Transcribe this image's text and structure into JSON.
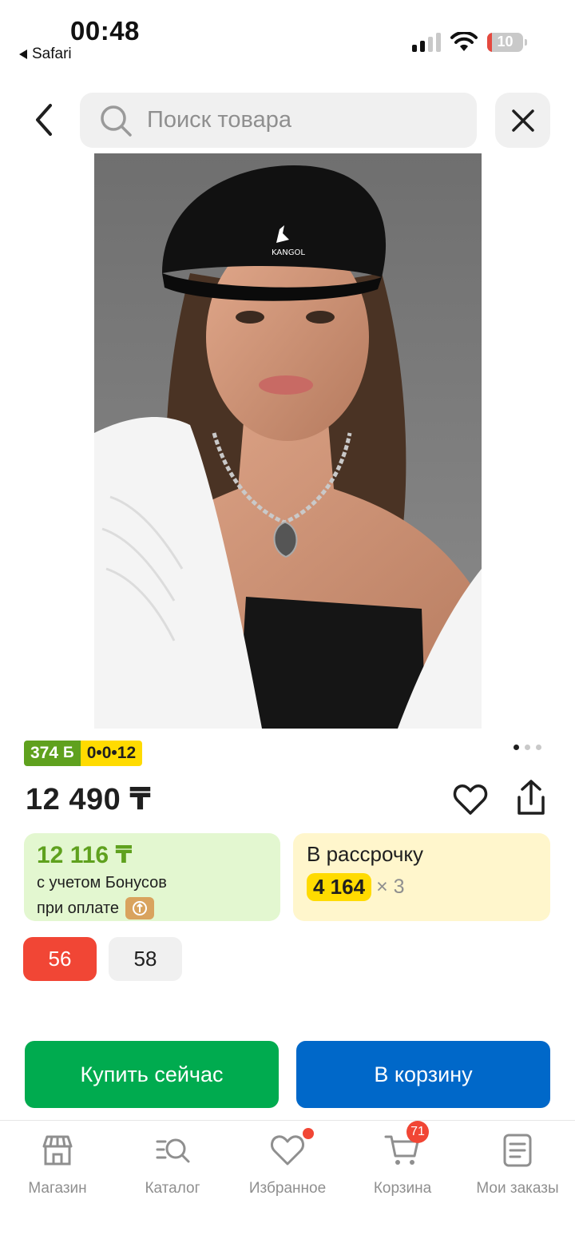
{
  "status_bar": {
    "time": "00:48",
    "back_app": "Safari",
    "battery": "10"
  },
  "header": {
    "search_placeholder": "Поиск товара"
  },
  "gallery": {
    "image_alt": "Женщина в чёрном берете KANGOL и белом пиджаке",
    "logo_text": "KANGOL",
    "pages": 3,
    "current_page": 1
  },
  "product": {
    "bonus_badge": "374",
    "bonus_symbol": "Б",
    "installment_badge": "0•0•12",
    "price": "12 490 ₸"
  },
  "bonus_card": {
    "amount": "12 116 ₸",
    "line1": "с учетом Бонусов",
    "line2": "при оплате"
  },
  "installment_card": {
    "label": "В рассрочку",
    "amount": "4 164",
    "times": "× 3"
  },
  "sizes": [
    "56",
    "58"
  ],
  "actions": {
    "buy_now": "Купить сейчас",
    "to_cart": "В корзину"
  },
  "tabs": [
    {
      "label": "Магазин",
      "icon": "shop-icon"
    },
    {
      "label": "Каталог",
      "icon": "catalog-search-icon"
    },
    {
      "label": "Избранное",
      "icon": "heart-icon"
    },
    {
      "label": "Корзина",
      "icon": "cart-icon",
      "badge": "71"
    },
    {
      "label": "Мои заказы",
      "icon": "orders-icon"
    }
  ],
  "colors": {
    "green": "#00ab4f",
    "blue": "#0068c9",
    "red": "#f14635",
    "yellow": "#ffdb00",
    "bonus_green": "#5fa11e"
  }
}
